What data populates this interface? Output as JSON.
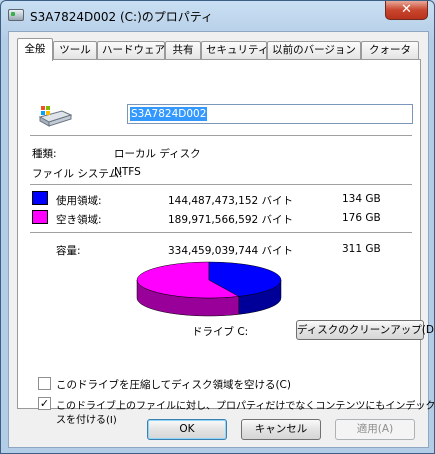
{
  "window": {
    "title": "S3A7824D002 (C:)のプロパティ",
    "close_label": "✕"
  },
  "tabs": [
    {
      "label": "全般",
      "active": true
    },
    {
      "label": "ツール",
      "active": false
    },
    {
      "label": "ハードウェア",
      "active": false
    },
    {
      "label": "共有",
      "active": false
    },
    {
      "label": "セキュリティ",
      "active": false
    },
    {
      "label": "以前のバージョン",
      "active": false
    },
    {
      "label": "クォータ",
      "active": false
    }
  ],
  "general": {
    "volume_name": "S3A7824D002",
    "type_label": "種類:",
    "type_value": "ローカル ディスク",
    "fs_label": "ファイル システム:",
    "fs_value": "NTFS",
    "used_label": "使用領域:",
    "used_bytes": "144,487,473,152 バイト",
    "used_size": "134 GB",
    "free_label": "空き領域:",
    "free_bytes": "189,971,566,592 バイト",
    "free_size": "176 GB",
    "capacity_label": "容量:",
    "capacity_bytes": "334,459,039,744 バイト",
    "capacity_size": "311 GB",
    "drive_label": "ドライブ C:",
    "cleanup_button": "ディスクのクリーンアップ(D)",
    "compress_label": "このドライブを圧縮してディスク領域を空ける(C)",
    "compress_checked": false,
    "index_label_line1": "このドライブ上のファイルに対し、プロパティだけでなくコンテンツにもインデック",
    "index_label_line2": "スを付ける(I)",
    "index_checked": true
  },
  "colors": {
    "used": "#0000ff",
    "free": "#ff00ff"
  },
  "usage": {
    "used_fraction": 0.432,
    "free_fraction": 0.568
  },
  "buttons": {
    "ok": "OK",
    "cancel": "キャンセル",
    "apply": "適用(A)"
  }
}
